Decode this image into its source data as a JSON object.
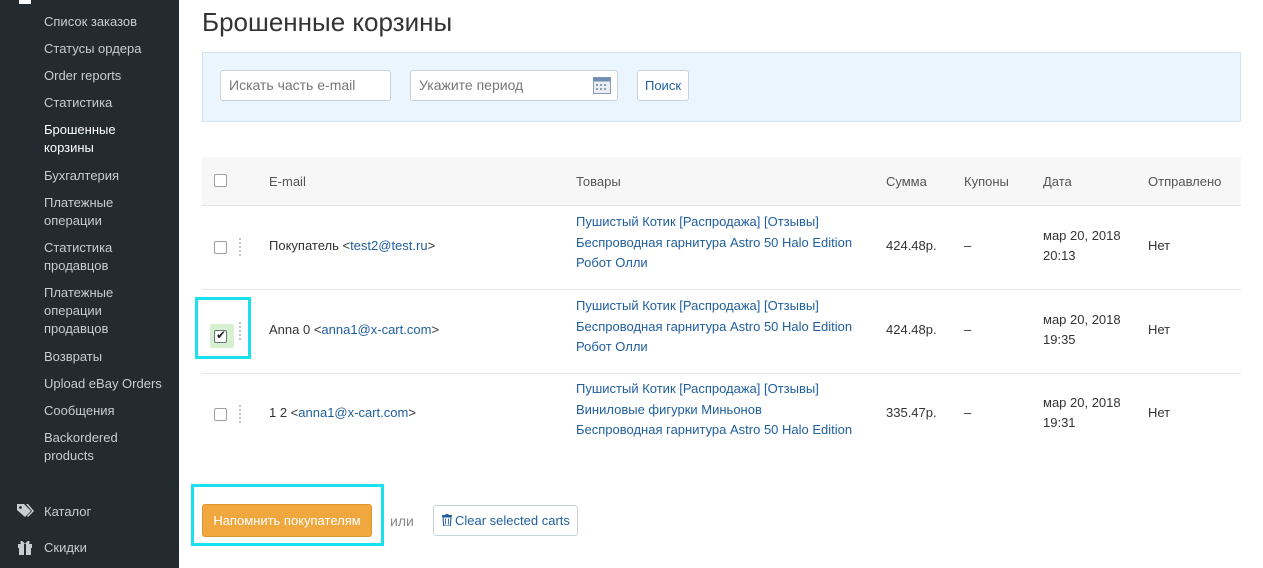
{
  "sidebar": {
    "items": [
      {
        "label": "Список заказов"
      },
      {
        "label": "Статусы ордера"
      },
      {
        "label": "Order reports"
      },
      {
        "label": "Статистика"
      },
      {
        "label": "Брошенные корзины",
        "active": true
      },
      {
        "label": "Бухгалтерия"
      },
      {
        "label": "Платежные операции"
      },
      {
        "label": "Статистика продавцов"
      },
      {
        "label": "Платежные операции продавцов"
      },
      {
        "label": "Возвраты"
      },
      {
        "label": "Upload eBay Orders"
      },
      {
        "label": "Сообщения"
      },
      {
        "label": "Backordered products"
      }
    ],
    "sections": [
      {
        "label": "Каталог",
        "icon": "tags-icon"
      },
      {
        "label": "Скидки",
        "icon": "gift-icon"
      }
    ]
  },
  "page": {
    "title": "Брошенные корзины"
  },
  "search": {
    "email_placeholder": "Искать часть e-mail",
    "period_placeholder": "Укажите период",
    "button_label": "Поиск"
  },
  "table": {
    "headers": {
      "email": "E-mail",
      "products": "Товары",
      "sum": "Сумма",
      "coupons": "Купоны",
      "date": "Дата",
      "sent": "Отправлено"
    },
    "rows": [
      {
        "checked": false,
        "name": "Покупатель <",
        "email": "test2@test.ru",
        "name_close": ">",
        "products": [
          "Пушистый Котик [Распродажа] [Отзывы]",
          "Беспроводная гарнитура Astro 50 Halo Edition",
          "Робот Олли"
        ],
        "sum": "424.48р.",
        "coupons": "–",
        "date": "мар 20, 2018",
        "time": "20:13",
        "sent": "Нет"
      },
      {
        "checked": true,
        "name": "Anna 0 <",
        "email": "anna1@x-cart.com",
        "name_close": ">",
        "products": [
          "Пушистый Котик [Распродажа] [Отзывы]",
          "Беспроводная гарнитура Astro 50 Halo Edition",
          "Робот Олли"
        ],
        "sum": "424.48р.",
        "coupons": "–",
        "date": "мар 20, 2018",
        "time": "19:35",
        "sent": "Нет"
      },
      {
        "checked": false,
        "name": "1 2 <",
        "email": "anna1@x-cart.com",
        "name_close": ">",
        "products": [
          "Пушистый Котик [Распродажа] [Отзывы]",
          "Виниловые фигурки Миньонов",
          "Беспроводная гарнитура Astro 50 Halo Edition"
        ],
        "sum": "335.47р.",
        "coupons": "–",
        "date": "мар 20, 2018",
        "time": "19:31",
        "sent": "Нет"
      }
    ]
  },
  "actions": {
    "remind_label": "Напомнить покупателям",
    "or_label": "или",
    "clear_label": "Clear selected carts"
  },
  "colors": {
    "sidebar_bg": "#232a30",
    "accent_orange": "#f0a73e",
    "link_blue": "#1f5e9e",
    "highlight_cyan": "#19e2ee",
    "search_panel_bg": "#ebf5fd"
  }
}
